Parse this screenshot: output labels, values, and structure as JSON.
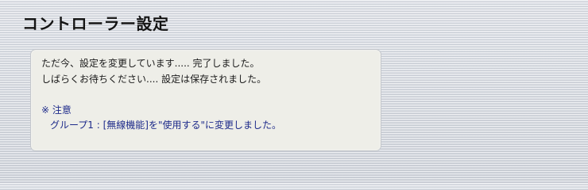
{
  "page": {
    "title": "コントローラー設定"
  },
  "message": {
    "line1": "ただ今、設定を変更しています..... 完了しました。",
    "line2": "しばらくお待ちください.... 設定は保存されました。",
    "note_heading": "※ 注意",
    "note_detail": "グループ1 : [無線機能]を\"使用する\"に変更しました。"
  }
}
